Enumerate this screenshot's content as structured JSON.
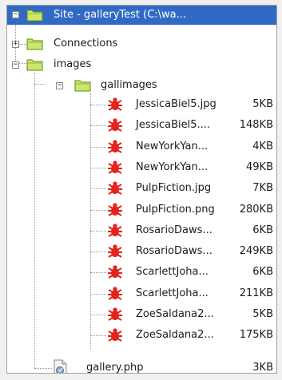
{
  "tree": {
    "root": {
      "label": "Site - galleryTest (C:\\wa...",
      "expander": "−"
    },
    "connections": {
      "label": "Connections",
      "expander": "+"
    },
    "images": {
      "label": "images",
      "expander": "−"
    },
    "gallimages": {
      "label": "gallimages",
      "expander": "−"
    },
    "files": [
      {
        "name": "JessicaBiel5.jpg",
        "size": "5KB"
      },
      {
        "name": "JessicaBiel5....",
        "size": "148KB"
      },
      {
        "name": "NewYorkYan...",
        "size": "4KB"
      },
      {
        "name": "NewYorkYan...",
        "size": "49KB"
      },
      {
        "name": "PulpFiction.jpg",
        "size": "7KB"
      },
      {
        "name": "PulpFiction.png",
        "size": "280KB"
      },
      {
        "name": "RosarioDaws...",
        "size": "6KB"
      },
      {
        "name": "RosarioDaws...",
        "size": "249KB"
      },
      {
        "name": "ScarlettJoha...",
        "size": "6KB"
      },
      {
        "name": "ScarlettJoha...",
        "size": "211KB"
      },
      {
        "name": "ZoeSaldana2...",
        "size": "5KB"
      },
      {
        "name": "ZoeSaldana2...",
        "size": "175KB"
      }
    ],
    "php": {
      "name": "gallery.php",
      "size": "3KB"
    }
  },
  "colors": {
    "selection": "#316ac5",
    "folder_fill": "#cbe86b",
    "folder_stroke": "#5f8a1a",
    "bug_red": "#e2241b"
  },
  "icons": {
    "folder": "folder-icon",
    "image_file": "image-file-icon",
    "php_file": "php-file-icon"
  }
}
